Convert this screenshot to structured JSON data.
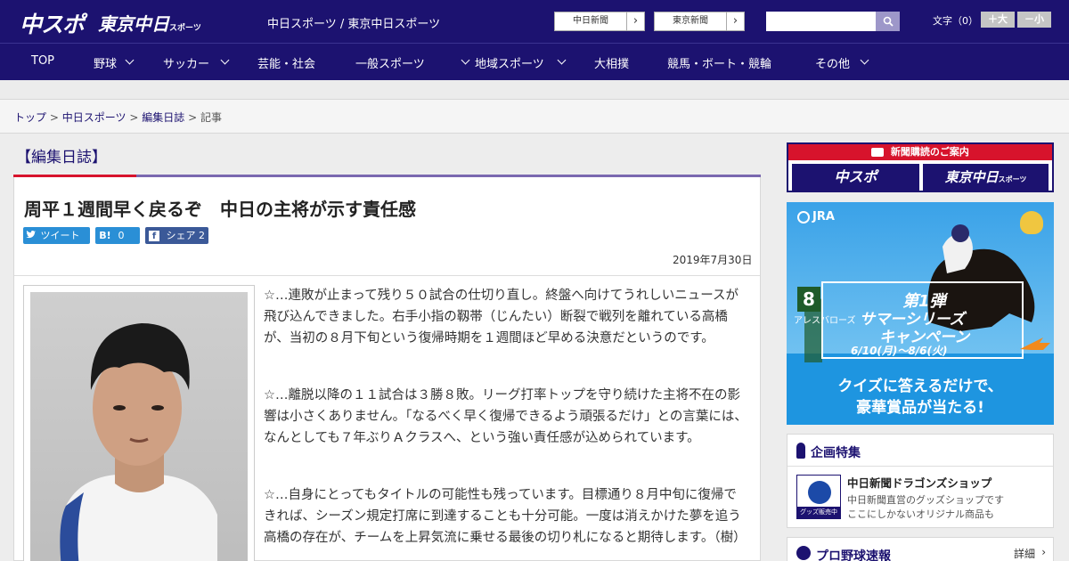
{
  "header": {
    "logo_main": "中スポ",
    "logo_tokyo": "東京中日",
    "logo_tokyo_small": "スポーツ",
    "tagline": "中日スポーツ / 東京中日スポーツ",
    "buttons": [
      {
        "label": "中日新聞"
      },
      {
        "label": "東京新聞"
      }
    ],
    "search": {
      "value": "",
      "placeholder": ""
    },
    "font_size_label": "文字（0）",
    "font_plus": "＋大",
    "font_minus": "－小",
    "brand_color": "#1c1270"
  },
  "nav": {
    "items": [
      {
        "label": "TOP",
        "dropdown": false
      },
      {
        "label": "野球",
        "dropdown": true
      },
      {
        "label": "サッカー",
        "dropdown": true
      },
      {
        "label": "芸能・社会",
        "dropdown": false
      },
      {
        "label": "一般スポーツ",
        "dropdown": true
      },
      {
        "label": "地域スポーツ",
        "dropdown": true
      },
      {
        "label": "大相撲",
        "dropdown": false
      },
      {
        "label": "競馬・ボート・競輪",
        "dropdown": false
      },
      {
        "label": "その他",
        "dropdown": true
      }
    ]
  },
  "breadcrumb": {
    "items": [
      "トップ",
      "中日スポーツ",
      "編集日誌"
    ],
    "current": "記事",
    "separator": ">"
  },
  "section": {
    "title": "【編集日誌】"
  },
  "article": {
    "title": "周平１週間早く戻るぞ　中日の主将が示す責任感",
    "share": {
      "tweet": "ツイート",
      "hatena_count": "0",
      "facebook": "シェア",
      "facebook_count": "2"
    },
    "date": "2019年7月30日",
    "paragraphs": [
      "☆…連敗が止まって残り５０試合の仕切り直し。終盤へ向けてうれしいニュースが飛び込んできました。右手小指の靱帯（じんたい）断裂で戦列を離れている高橋が、当初の８月下旬という復帰時期を１週間ほど早める決意だというのです。",
      "☆…離脱以降の１１試合は３勝８敗。リーグ打率トップを守り続けた主将不在の影響は小さくありません。「なるべく早く復帰できるよう頑張るだけ」との言葉には、なんとしても７年ぶりＡクラスへ、という強い責任感が込められています。",
      "☆…自身にとってもタイトルの可能性も残っています。目標通り８月中旬に復帰できれば、シーズン規定打席に到達することも十分可能。一度は消えかけた夢を追う高橋の存在が、チームを上昇気流に乗せる最後の切り札になると期待します。（樹）"
    ]
  },
  "sidebar": {
    "promo": {
      "title": "新聞購読のご案内",
      "btn1": "中スポ",
      "btn2": "東京中日",
      "btn2_small": "スポーツ"
    },
    "jra": {
      "logo": "JRA",
      "number": "8",
      "horse_name": "アレスバローズ",
      "round": "第1弾",
      "campaign_line1": "サマーシリーズ",
      "campaign_line2": "キャンペーン",
      "dates": "6/10(月)～8/6(火)",
      "cta_line1": "クイズに答えるだけで、",
      "cta_line2": "豪華賞品が当たる!"
    },
    "feature": {
      "heading": "企画特集",
      "item_title": "中日新聞ドラゴンズショップ",
      "item_desc1": "中日新聞直営のグッズショップです",
      "item_desc2": "ここにしかないオリジナル商品も",
      "thumb_label": "グッズ販売中"
    },
    "baseball": {
      "heading": "プロ野球速報",
      "more": "詳細"
    }
  }
}
